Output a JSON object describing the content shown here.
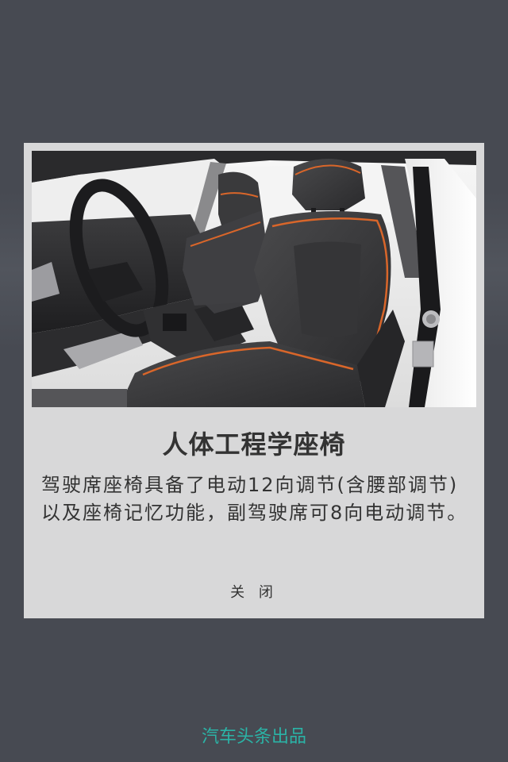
{
  "modal": {
    "image_alt": "汽车前排座椅",
    "title": "人体工程学座椅",
    "body": "驾驶席座椅具备了电动12向调节(含腰部调节)以及座椅记忆功能，副驾驶席可8向电动调节。",
    "close_label": "关 闭"
  },
  "footer": {
    "credit": "汽车头条出品"
  },
  "colors": {
    "page_background": "#474a52",
    "card_background": "#d8d8d9",
    "footer_accent": "#2bb3a6",
    "seat_stitch": "#d9662a"
  }
}
